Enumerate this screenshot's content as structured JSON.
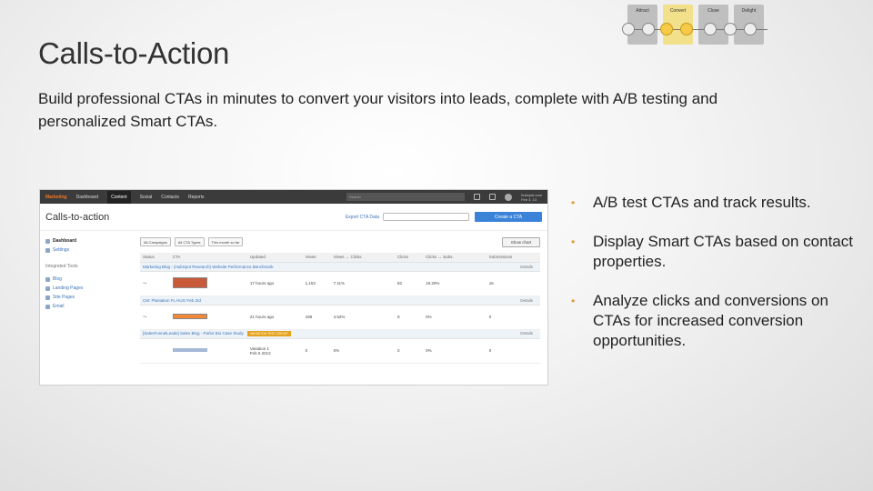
{
  "slide": {
    "title": "Calls-to-Action",
    "subtitle": "Build professional CTAs in minutes to convert your visitors into leads, complete with A/B testing and personalized Smart CTAs."
  },
  "flow": {
    "steps": [
      "Attract",
      "Convert",
      "Close",
      "Delight"
    ],
    "active_index": 1,
    "colors": {
      "step": "#bfbfbf",
      "active": "#f2e08a",
      "node_active": "#f7c948"
    }
  },
  "screenshot": {
    "nav": {
      "logo": "Marketing",
      "items": [
        "Dashboard",
        "Content",
        "Social",
        "Contacts",
        "Reports"
      ],
      "active_item": "Content",
      "search_placeholder": "Search",
      "account": "hubspot.com",
      "account_sub": "Feb 3, 13"
    },
    "header": {
      "title": "Calls-to-action",
      "export_label": "Export CTA Data",
      "create_label": "Create a CTA"
    },
    "sidebar": {
      "items": [
        "Dashboard",
        "Settings"
      ],
      "tools_heading": "Integrated Tools",
      "tools": [
        "Blog",
        "Landing Pages",
        "Site Pages",
        "Email"
      ]
    },
    "filters": [
      "All Campaigns",
      "All CTA Types",
      "This month so far"
    ],
    "show_chart_label": "Show chart",
    "columns": [
      "Status",
      "CTA",
      "Updated",
      "Views",
      "Views → Clicks",
      "Clicks",
      "Clicks → Subs.",
      "Submissions"
    ],
    "groups": [
      {
        "name": "Marketing Blog - (HubSpot Research) Website Performance Benchmark",
        "badge": "",
        "details": "Details",
        "row": {
          "updated": "17 hours ago",
          "views": "1,153",
          "view_click": "7.11%",
          "clicks": "82",
          "click_sub": "19.20%",
          "subs": "16"
        }
      },
      {
        "name": "CM: Plantation FL HUG Feb 3rd",
        "badge": "",
        "details": "Details",
        "row": {
          "updated": "21 hours ago",
          "views": "199",
          "view_click": "4.52%",
          "clicks": "9",
          "click_sub": "0%",
          "subs": "0"
        }
      },
      {
        "name": "[SalesFunnelLeads] Sales Blog - Parlor Bio Case Study",
        "badge": "VARIATION TEST GROUP",
        "details": "Details",
        "row": {
          "updated": "Variation 1",
          "updated_sub": "Feb 5 2013",
          "views": "0",
          "view_click": "0%",
          "clicks": "0",
          "click_sub": "0%",
          "subs": "0"
        }
      }
    ]
  },
  "bullets": [
    "A/B test CTAs and track results.",
    "Display Smart CTAs based on contact properties.",
    "Analyze clicks and conversions on CTAs for increased conversion opportunities."
  ],
  "bullet_mark": "•",
  "colors": {
    "accent": "#e49a2c",
    "link": "#3b73b9",
    "button": "#3b83d8"
  }
}
